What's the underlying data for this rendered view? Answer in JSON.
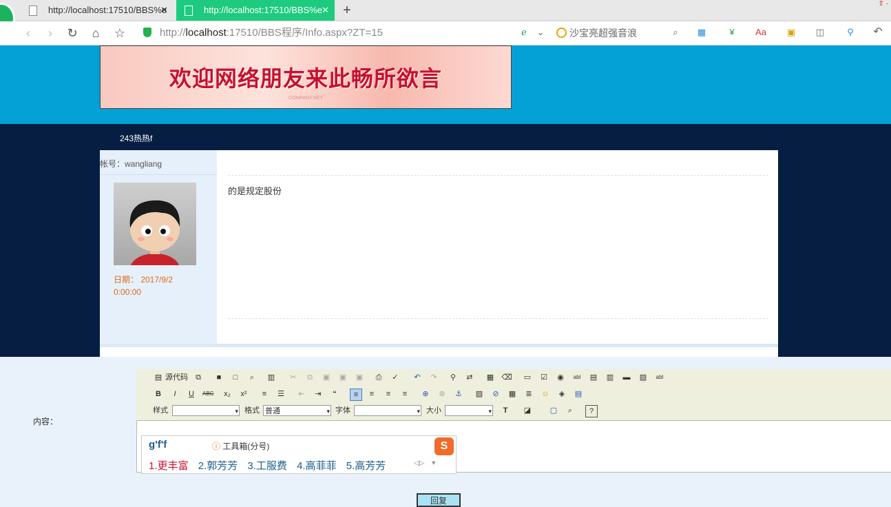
{
  "browser": {
    "tabs": [
      {
        "title": "http://localhost:17510/BBS%e",
        "close": "✕"
      },
      {
        "title": "http://localhost:17510/BBS%e",
        "close": "✕"
      }
    ],
    "new_tab": "+",
    "url_prefix": "http://",
    "url_host": "localhost",
    "url_rest": ":17510/BBS程序/Info.aspx?ZT=15",
    "search_text": "沙宝亮超强音浪"
  },
  "banner": {
    "title": "欢迎网络朋友来此畅所欲言",
    "subtitle": "COMPANY.NET"
  },
  "topic": {
    "title": "243热热f"
  },
  "post": {
    "account_label": "帐号：wangliang",
    "date_line1": "日期：  2017/9/2",
    "date_line2": "0:00:00",
    "content": "的是规定股份"
  },
  "reply": {
    "label": "内容：",
    "button": "回复"
  },
  "editor": {
    "source_label": "源代码",
    "style_label": "样式",
    "format_label": "格式",
    "format_value": "普通",
    "font_label": "字体",
    "size_label": "大小"
  },
  "ime": {
    "input": "g'f'f",
    "toolbox": "工具箱(分号)",
    "candidates": [
      "1.更丰富",
      "2.郭芳芳",
      "3.工服费",
      "4.高菲菲",
      "5.高芳芳"
    ]
  }
}
